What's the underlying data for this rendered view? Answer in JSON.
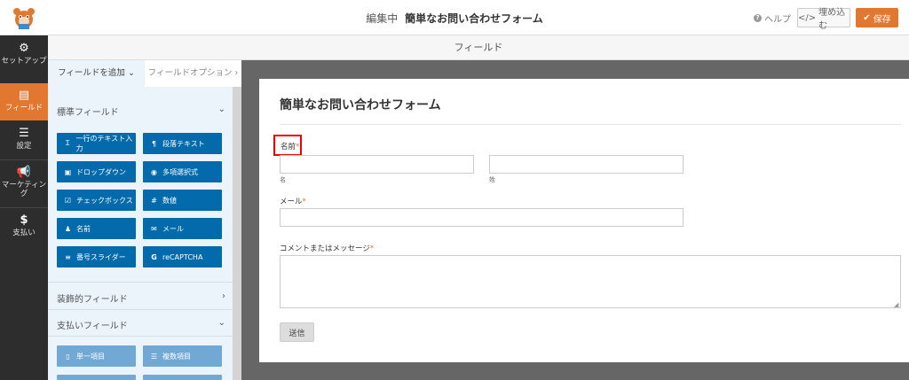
{
  "header": {
    "editing_label": "編集中",
    "form_name": "簡単なお問い合わせフォーム",
    "help_label": "ヘルプ",
    "embed_label": "埋め込む",
    "save_label": "保存"
  },
  "nav": {
    "items": [
      {
        "label": "セットアップ",
        "icon": "gear-icon"
      },
      {
        "label": "フィールド",
        "icon": "fields-icon"
      },
      {
        "label": "設定",
        "icon": "sliders-icon"
      },
      {
        "label": "マーケティング",
        "icon": "megaphone-icon"
      },
      {
        "label": "支払い",
        "icon": "dollar-icon"
      }
    ]
  },
  "subheader": {
    "title": "フィールド"
  },
  "panel": {
    "tabs": {
      "add": "フィールドを追加",
      "options": "フィールドオプション"
    },
    "standard_title": "標準フィールド",
    "standard_fields": [
      {
        "label": "一行のテキスト入力",
        "icon": "text-icon"
      },
      {
        "label": "段落テキスト",
        "icon": "paragraph-icon"
      },
      {
        "label": "ドロップダウン",
        "icon": "dropdown-icon"
      },
      {
        "label": "多項選択式",
        "icon": "radio-icon"
      },
      {
        "label": "チェックボックス",
        "icon": "checkbox-icon"
      },
      {
        "label": "数値",
        "icon": "hash-icon"
      },
      {
        "label": "名前",
        "icon": "user-icon"
      },
      {
        "label": "メール",
        "icon": "envelope-icon"
      },
      {
        "label": "番号スライダー",
        "icon": "slider-icon"
      },
      {
        "label": "reCAPTCHA",
        "icon": "google-icon"
      }
    ],
    "fancy_title": "装飾的フィールド",
    "payment_title": "支払いフィールド",
    "payment_fields": [
      {
        "label": "単一項目",
        "icon": "file-icon"
      },
      {
        "label": "複数項目",
        "icon": "list-icon"
      }
    ]
  },
  "form": {
    "title": "簡単なお問い合わせフォーム",
    "name_label": "名前",
    "first_sublabel": "名",
    "last_sublabel": "姓",
    "email_label": "メール",
    "message_label": "コメントまたはメッセージ",
    "required_mark": "*",
    "submit_label": "送信"
  },
  "colors": {
    "accent": "#e27730",
    "button": "#036aab",
    "nav_bg": "#2d2d2d"
  }
}
